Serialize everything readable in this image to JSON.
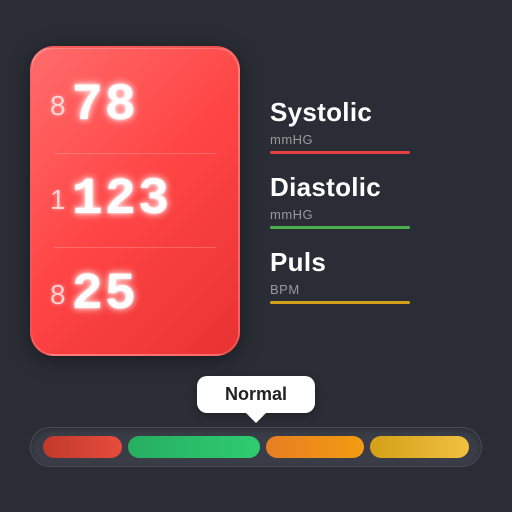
{
  "monitor": {
    "systolic_value": "78",
    "diastolic_value": "123",
    "pulse_value": "25",
    "systolic_prefix": "8",
    "diastolic_prefix": "1",
    "pulse_prefix": "8"
  },
  "labels": {
    "systolic": "Systolic",
    "systolic_unit": "mmHG",
    "diastolic": "Diastolic",
    "diastolic_unit": "mmHG",
    "puls": "Puls",
    "puls_unit": "BPM",
    "status": "Normal"
  },
  "scale": {
    "segments": [
      "red",
      "green",
      "orange",
      "yellow"
    ]
  }
}
